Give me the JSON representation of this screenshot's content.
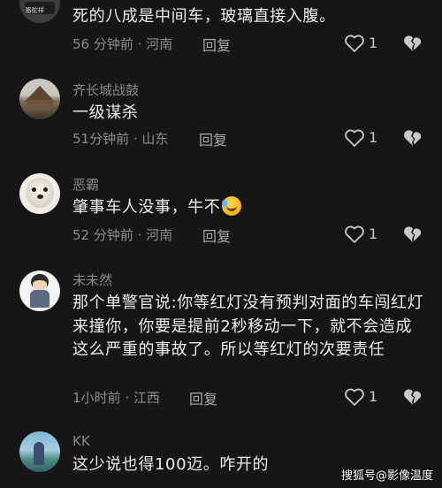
{
  "comments": [
    {
      "username": "",
      "avatar_label": "骆驼祥",
      "text": "死的八成是中间车，玻璃直接入腹。",
      "time": "56 分钟前",
      "location": "河南",
      "reply": "回复",
      "likes": "1"
    },
    {
      "username": "齐长城战鼓",
      "text": "一级谋杀",
      "time": "51分钟前",
      "location": "山东",
      "reply": "回复",
      "likes": "1"
    },
    {
      "username": "恶霸",
      "text": "肇事车人没事，牛不",
      "emoji": "rofl-emoji",
      "time": "52 分钟前",
      "location": "河南",
      "reply": "回复",
      "likes": "1"
    },
    {
      "username": "未未然",
      "text": "那个单警官说:你等红灯没有预判对面的车闯红灯来撞你，你要是提前2秒移动一下，就不会造成这么严重的事故了。所以等红灯的次要责任",
      "time": "1小时前",
      "location": "江西",
      "reply": "回复",
      "likes": "1"
    },
    {
      "username": "KK",
      "text": "这少说也得100迈。咋开的"
    }
  ],
  "separator": " · ",
  "watermark": "搜狐号@影像温度",
  "icons": {
    "like": "heart-outline-icon",
    "dislike": "broken-heart-icon"
  },
  "colors": {
    "background": "#161616",
    "text": "#ececec",
    "secondary": "#8d8d8d"
  }
}
